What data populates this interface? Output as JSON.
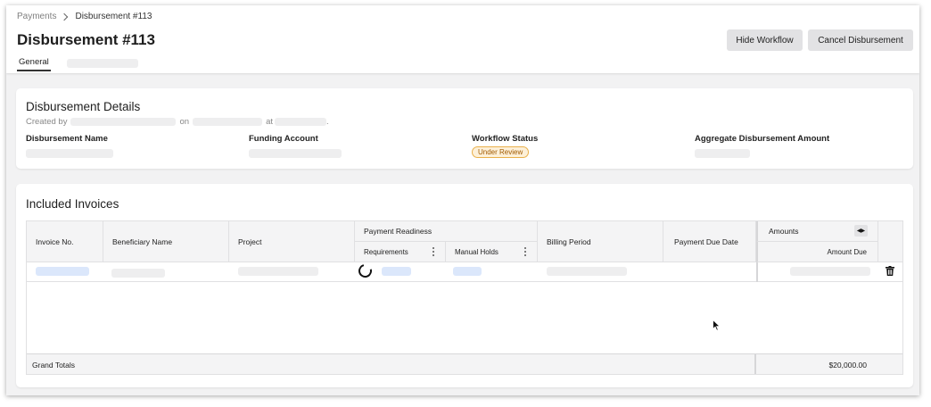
{
  "breadcrumb": {
    "parent": "Payments",
    "current": "Disbursement #113"
  },
  "page": {
    "title": "Disbursement #113"
  },
  "tabs": [
    {
      "label": "General",
      "active": true
    }
  ],
  "actions": {
    "hide_workflow": "Hide Workflow",
    "cancel_disbursement": "Cancel Disbursement"
  },
  "details": {
    "title": "Disbursement Details",
    "created_by_label": "Created by",
    "on_label": "on",
    "at_label": "at",
    "period": ".",
    "fields": {
      "name_label": "Disbursement Name",
      "funding_label": "Funding Account",
      "workflow_label": "Workflow Status",
      "workflow_status": "Under Review",
      "aggregate_label": "Aggregate Disbursement Amount"
    }
  },
  "invoices": {
    "title": "Included Invoices",
    "columns": {
      "invoice_no": "Invoice No.",
      "beneficiary": "Beneficiary Name",
      "project": "Project",
      "payment_readiness": "Payment Readiness",
      "requirements": "Requirements",
      "manual_holds": "Manual Holds",
      "billing_period": "Billing Period",
      "payment_due_date": "Payment Due Date",
      "amounts": "Amounts",
      "amount_due": "Amount Due"
    },
    "totals": {
      "label": "Grand Totals",
      "amount_due": "$20,000.00"
    }
  },
  "colors": {
    "accent_badge_bg": "#fdf0d8",
    "accent_badge_border": "#e9b04a",
    "loading_skeleton_blue": "#dbe7fb"
  },
  "icons": {
    "breadcrumb_separator": "chevron-right-icon",
    "delete": "trash-icon",
    "column_menu": "kebab-menu-icon",
    "expand_columns": "arrows-left-right-icon",
    "loading": "spinner-icon"
  }
}
